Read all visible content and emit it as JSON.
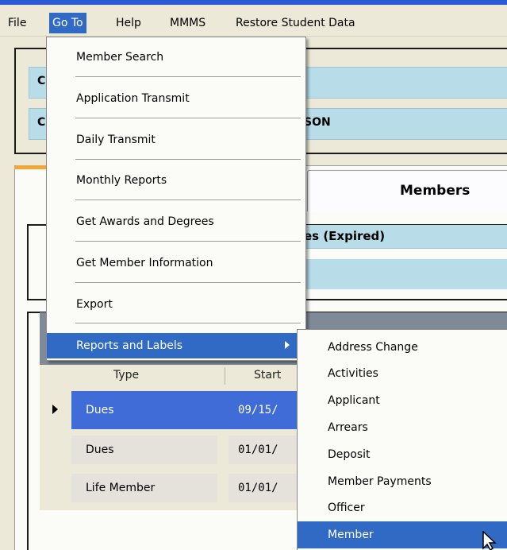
{
  "menubar": {
    "items": [
      "File",
      "Go To",
      "Help",
      "MMMS",
      "Restore Student Data"
    ],
    "active": "Go To"
  },
  "background": {
    "field1_prefix": "C",
    "field2_prefix": "C",
    "field2_value": "SON",
    "tab_members": "Members",
    "dues_header": "es (Expired)",
    "grid": {
      "columns": [
        "Type",
        "Start"
      ],
      "rows": [
        {
          "type": "Dues",
          "start": "09/15/",
          "selected": true
        },
        {
          "type": "Dues",
          "start": "01/01/",
          "selected": false
        },
        {
          "type": "Life Member",
          "start": "01/01/",
          "selected": false
        }
      ]
    }
  },
  "goto_menu": {
    "items": [
      "Member Search",
      "Application Transmit",
      "Daily Transmit",
      "Monthly Reports",
      "Get Awards and Degrees",
      "Get Member Information",
      "Export",
      "Reports and Labels"
    ],
    "highlighted": "Reports and Labels"
  },
  "submenu": {
    "items": [
      "Address Change",
      "Activities",
      "Applicant",
      "Arrears",
      "Deposit",
      "Member Payments",
      "Officer",
      "Member"
    ],
    "highlighted": "Member"
  },
  "colors": {
    "highlight": "#316ac5",
    "field_blue": "#b8dde8",
    "menubar_bg": "#ece9d8"
  }
}
